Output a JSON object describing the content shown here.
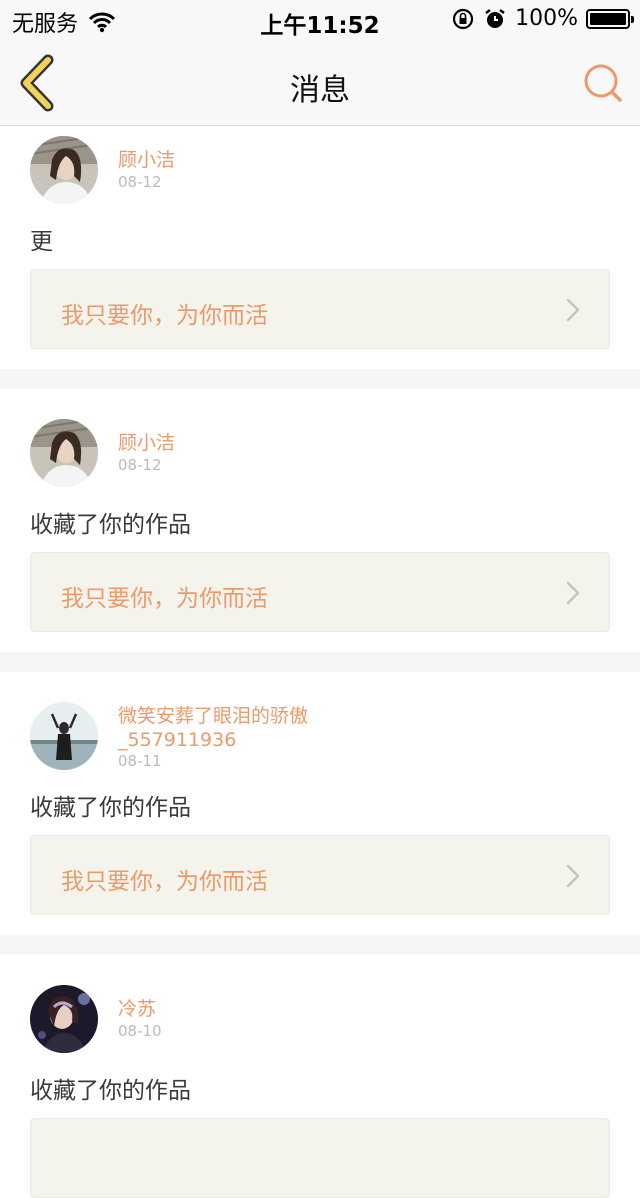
{
  "status_bar": {
    "carrier": "无服务",
    "time": "上午11:52",
    "battery": "100%"
  },
  "nav": {
    "title": "消息"
  },
  "messages": [
    {
      "name": "顾小洁",
      "date": "08-12",
      "action": "更",
      "work_title": "我只要你，为你而活"
    },
    {
      "name": "顾小洁",
      "date": "08-12",
      "action": "收藏了你的作品",
      "work_title": "我只要你，为你而活"
    },
    {
      "name": "微笑安葬了眼泪的骄傲_557911936",
      "date": "08-11",
      "action": "收藏了你的作品",
      "work_title": "我只要你，为你而活"
    },
    {
      "name": "冷苏",
      "date": "08-10",
      "action": "收藏了你的作品",
      "work_title": ""
    }
  ],
  "colors": {
    "accent": "#eb9a6b",
    "back_icon": "#f3d25a",
    "work_bg": "#f5f4ec",
    "separator": "#f6f5f7"
  },
  "icons": {
    "back": "chevron-left-icon",
    "search": "search-icon",
    "wifi": "wifi-icon",
    "lock_rotation": "rotation-lock-icon",
    "alarm": "alarm-icon",
    "battery": "battery-icon",
    "work_arrow": "chevron-right-icon"
  }
}
